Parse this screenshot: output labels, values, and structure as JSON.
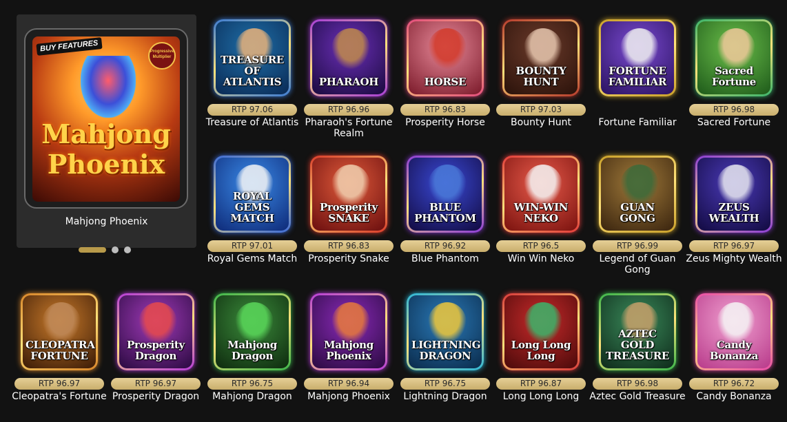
{
  "featured": {
    "badge_left": "BUY FEATURES",
    "badge_right": "Progressive Multiplier",
    "art_title": "Mahjong Phoenix",
    "caption": "Mahjong Phoenix",
    "carousel": {
      "total": 3,
      "active": 0
    }
  },
  "games": [
    {
      "tile_title": "TREASURE OF ATLANTIS",
      "rtp": "RTP 97.06",
      "name": "Treasure of Atlantis",
      "frame": "#3a7bd5",
      "bg1": "#1f6fa8",
      "bg2": "#0a2a55",
      "fig": "#e9b27a"
    },
    {
      "tile_title": "PHARAOH",
      "rtp": "RTP 96.96",
      "name": "Pharaoh's Fortune Realm",
      "frame": "#a53bd8",
      "bg1": "#6b2fb8",
      "bg2": "#1a0a3e",
      "fig": "#c08a4a"
    },
    {
      "tile_title": "HORSE",
      "rtp": "RTP 96.83",
      "name": "Prosperity Horse",
      "frame": "#e24a7c",
      "bg1": "#e88a9a",
      "bg2": "#7b1a2a",
      "fig": "#d23a2a"
    },
    {
      "tile_title": "BOUNTY HUNT",
      "rtp": "RTP 97.03",
      "name": "Bounty Hunt",
      "frame": "#b5392b",
      "bg1": "#6b3a2a",
      "bg2": "#2a120a",
      "fig": "#e8c8b0"
    },
    {
      "tile_title": "FORTUNE FAMILIAR",
      "rtp": "",
      "name": "Fortune Familiar",
      "frame": "#c9a02a",
      "bg1": "#7a4ad0",
      "bg2": "#2a1260",
      "fig": "#f0f0f0"
    },
    {
      "tile_title": "Sacred Fortune",
      "rtp": "RTP 96.98",
      "name": "Sacred Fortune",
      "frame": "#3ab56b",
      "bg1": "#6bbf4a",
      "bg2": "#1e5a1a",
      "fig": "#f0c89a"
    },
    {
      "tile_title": "ROYAL GEMS MATCH",
      "rtp": "RTP 97.01",
      "name": "Royal Gems Match",
      "frame": "#3a6ad8",
      "bg1": "#3a8ae8",
      "bg2": "#0e2a78",
      "fig": "#f5f5f5"
    },
    {
      "tile_title": "Prosperity SNAKE",
      "rtp": "RTP 96.83",
      "name": "Prosperity Snake",
      "frame": "#d83a2a",
      "bg1": "#e05a3a",
      "bg2": "#6a0e0e",
      "fig": "#f0d0b0"
    },
    {
      "tile_title": "BLUE PHANTOM",
      "rtp": "RTP 96.92",
      "name": "Blue Phantom",
      "frame": "#8a3ad8",
      "bg1": "#3a4ad8",
      "bg2": "#120a40",
      "fig": "#4a7ad8"
    },
    {
      "tile_title": "WIN-WIN NEKO",
      "rtp": "RTP 96.5",
      "name": "Win Win Neko",
      "frame": "#e23a3a",
      "bg1": "#e85a4a",
      "bg2": "#7a120e",
      "fig": "#f5f5f5"
    },
    {
      "tile_title": "GUAN GONG",
      "rtp": "RTP 96.99",
      "name": "Legend of Guan Gong",
      "frame": "#c9a02a",
      "bg1": "#a07a3a",
      "bg2": "#3a240e",
      "fig": "#3a6a3a"
    },
    {
      "tile_title": "ZEUS WEALTH",
      "rtp": "RTP 96.97",
      "name": "Zeus Mighty Wealth",
      "frame": "#8a3ad8",
      "bg1": "#4a3ab8",
      "bg2": "#120a40",
      "fig": "#e8e8f0"
    },
    {
      "tile_title": "CLEOPATRA'S FORTUNE",
      "rtp": "RTP 96.97",
      "name": "Cleopatra's Fortune",
      "frame": "#d8862a",
      "bg1": "#c87a2a",
      "bg2": "#3a1a06",
      "fig": "#c08a5a"
    },
    {
      "tile_title": "Prosperity Dragon",
      "rtp": "RTP 96.97",
      "name": "Prosperity Dragon",
      "frame": "#b53ad8",
      "bg1": "#a03ab8",
      "bg2": "#2a0a40",
      "fig": "#e84a4a"
    },
    {
      "tile_title": "Mahjong Dragon",
      "rtp": "RTP 96.75",
      "name": "Mahjong Dragon",
      "frame": "#3ab54a",
      "bg1": "#3a8a3a",
      "bg2": "#0e2a0e",
      "fig": "#5ad85a"
    },
    {
      "tile_title": "Mahjong Phoenix",
      "rtp": "RTP 96.94",
      "name": "Mahjong Phoenix",
      "frame": "#b53ad8",
      "bg1": "#8a2ab8",
      "bg2": "#2a0a40",
      "fig": "#e87a3a"
    },
    {
      "tile_title": "LIGHTNING DRAGON",
      "rtp": "RTP 96.75",
      "name": "Lightning Dragon",
      "frame": "#2ab5d8",
      "bg1": "#2a7ab8",
      "bg2": "#0a2a4a",
      "fig": "#f0c83a"
    },
    {
      "tile_title": "Long Long Long",
      "rtp": "RTP 96.87",
      "name": "Long Long Long",
      "frame": "#d83a3a",
      "bg1": "#c82a2a",
      "bg2": "#4a0a0a",
      "fig": "#3ab56b"
    },
    {
      "tile_title": "AZTEC GOLD TREASURE",
      "rtp": "RTP 96.98",
      "name": "Aztec Gold Treasure",
      "frame": "#3ab54a",
      "bg1": "#3a8a5a",
      "bg2": "#0e2a1a",
      "fig": "#c8a06a"
    },
    {
      "tile_title": "Candy Bonanza",
      "rtp": "RTP 96.72",
      "name": "Candy Bonanza",
      "frame": "#e84aa8",
      "bg1": "#f0a0d0",
      "bg2": "#b83a8a",
      "fig": "#f5f5f5"
    }
  ]
}
